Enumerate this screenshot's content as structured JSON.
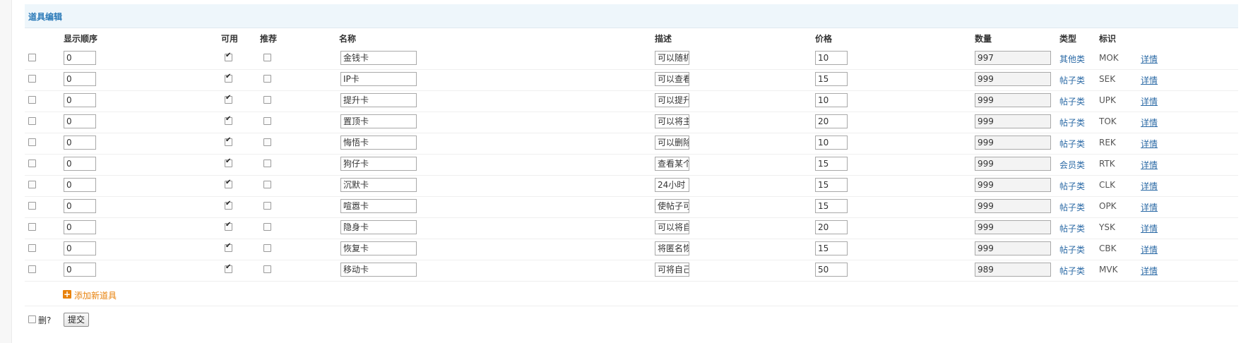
{
  "panel": {
    "title": "道具编辑"
  },
  "headers": {
    "order": "显示顺序",
    "enabled": "可用",
    "recommend": "推荐",
    "name": "名称",
    "desc": "描述",
    "price": "价格",
    "stock": "数量",
    "type": "类型",
    "tag": "标识"
  },
  "rows": [
    {
      "order": "0",
      "enabled": true,
      "recommend": false,
      "name": "金钱卡",
      "desc": "可以随机",
      "price": "10",
      "stock": "997",
      "type": "其他类",
      "tag": "MOK",
      "detail": "详情"
    },
    {
      "order": "0",
      "enabled": true,
      "recommend": false,
      "name": "IP卡",
      "desc": "可以查看",
      "price": "15",
      "stock": "999",
      "type": "帖子类",
      "tag": "SEK",
      "detail": "详情"
    },
    {
      "order": "0",
      "enabled": true,
      "recommend": false,
      "name": "提升卡",
      "desc": "可以提升",
      "price": "10",
      "stock": "999",
      "type": "帖子类",
      "tag": "UPK",
      "detail": "详情"
    },
    {
      "order": "0",
      "enabled": true,
      "recommend": false,
      "name": "置顶卡",
      "desc": "可以将主",
      "price": "20",
      "stock": "999",
      "type": "帖子类",
      "tag": "TOK",
      "detail": "详情"
    },
    {
      "order": "0",
      "enabled": true,
      "recommend": false,
      "name": "悔悟卡",
      "desc": "可以删除",
      "price": "10",
      "stock": "999",
      "type": "帖子类",
      "tag": "REK",
      "detail": "详情"
    },
    {
      "order": "0",
      "enabled": true,
      "recommend": false,
      "name": "狗仔卡",
      "desc": "查看某个",
      "price": "15",
      "stock": "999",
      "type": "会员类",
      "tag": "RTK",
      "detail": "详情"
    },
    {
      "order": "0",
      "enabled": true,
      "recommend": false,
      "name": "沉默卡",
      "desc": "24小时",
      "price": "15",
      "stock": "999",
      "type": "帖子类",
      "tag": "CLK",
      "detail": "详情"
    },
    {
      "order": "0",
      "enabled": true,
      "recommend": false,
      "name": "喧嚣卡",
      "desc": "使帖子可",
      "price": "15",
      "stock": "999",
      "type": "帖子类",
      "tag": "OPK",
      "detail": "详情"
    },
    {
      "order": "0",
      "enabled": true,
      "recommend": false,
      "name": "隐身卡",
      "desc": "可以将自",
      "price": "20",
      "stock": "999",
      "type": "帖子类",
      "tag": "YSK",
      "detail": "详情"
    },
    {
      "order": "0",
      "enabled": true,
      "recommend": false,
      "name": "恢复卡",
      "desc": "将匿名恢",
      "price": "15",
      "stock": "999",
      "type": "帖子类",
      "tag": "CBK",
      "detail": "详情"
    },
    {
      "order": "0",
      "enabled": true,
      "recommend": false,
      "name": "移动卡",
      "desc": "可将自己",
      "price": "50",
      "stock": "989",
      "type": "帖子类",
      "tag": "MVK",
      "detail": "详情"
    }
  ],
  "add_new": "添加新道具",
  "footer": {
    "delete_label": "删?",
    "submit_label": "提交"
  },
  "colors": {
    "accent": "#2b7ab8",
    "link": "#2b6aa6",
    "add": "#e8820c"
  }
}
